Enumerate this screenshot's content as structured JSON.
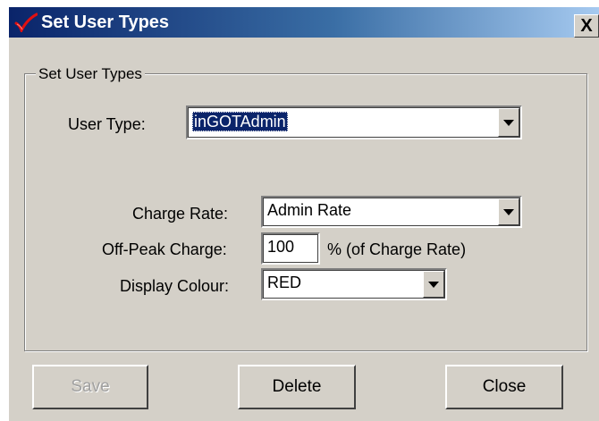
{
  "window": {
    "title": "Set User Types",
    "close_glyph": "X",
    "title_icon": "check-mark-icon"
  },
  "group": {
    "legend": "Set User Types"
  },
  "form": {
    "user_type": {
      "label": "User Type:",
      "value": "inGOTAdmin"
    },
    "charge_rate": {
      "label": "Charge Rate:",
      "value": "Admin Rate"
    },
    "off_peak": {
      "label": "Off-Peak Charge:",
      "value": "100",
      "suffix": "% (of Charge Rate)"
    },
    "display_colour": {
      "label": "Display Colour:",
      "value": "RED"
    }
  },
  "buttons": {
    "save": "Save",
    "delete": "Delete",
    "close": "Close"
  },
  "colors": {
    "titlebar_start": "#0a246a",
    "titlebar_end": "#a6caf0",
    "face": "#d4d0c8",
    "selection": "#0a246a"
  }
}
